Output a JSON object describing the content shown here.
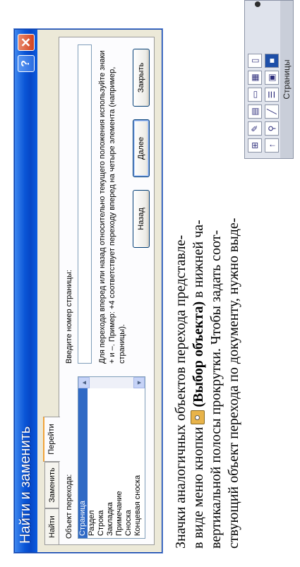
{
  "dialog": {
    "title": "Найти и заменить",
    "help_label": "?",
    "close_label": "✕",
    "tabs": [
      {
        "label": "Найти"
      },
      {
        "label": "Заменить"
      },
      {
        "label": "Перейти"
      }
    ],
    "object_label": "Объект перехода:",
    "objects": [
      "Страница",
      "Раздел",
      "Строка",
      "Закладка",
      "Примечание",
      "Сноска",
      "Концевая сноска"
    ],
    "selected_object": "Страница",
    "page_input_label": "Введите номер страницы:",
    "page_input_value": "",
    "hint": "Для перехода вперед или назад относительно текущего положения используйте знаки + и –. Пример: +4 соответствует переходу вперед на четыре элемента (например, страницы).",
    "buttons": {
      "prev": "Назад",
      "next": "Далее",
      "close": "Закрыть"
    }
  },
  "body_text": {
    "line1": "Значки аналогичных объектов перехода представле-",
    "line2_a": "в виде меню кнопки",
    "line2_b": "(Выбор объекта)",
    "line2_c": "в нижней ча-",
    "line3": "вертикальной полосы прокрутки. Чтобы задать соот-",
    "line4": "ствующий объект перехода по документу, нужно выде-"
  },
  "palette": {
    "caption": "Страницы",
    "icons": [
      "field-icon",
      "edit-icon",
      "comment-icon",
      "page-icon",
      "arrow-up-icon",
      "find-icon",
      "pen-icon",
      "endnote-icon",
      "heading-icon",
      "section-icon",
      "footnote-icon",
      "table-icon",
      "graphic-icon",
      "goto-icon",
      "bookmark-icon",
      "line-icon"
    ]
  }
}
